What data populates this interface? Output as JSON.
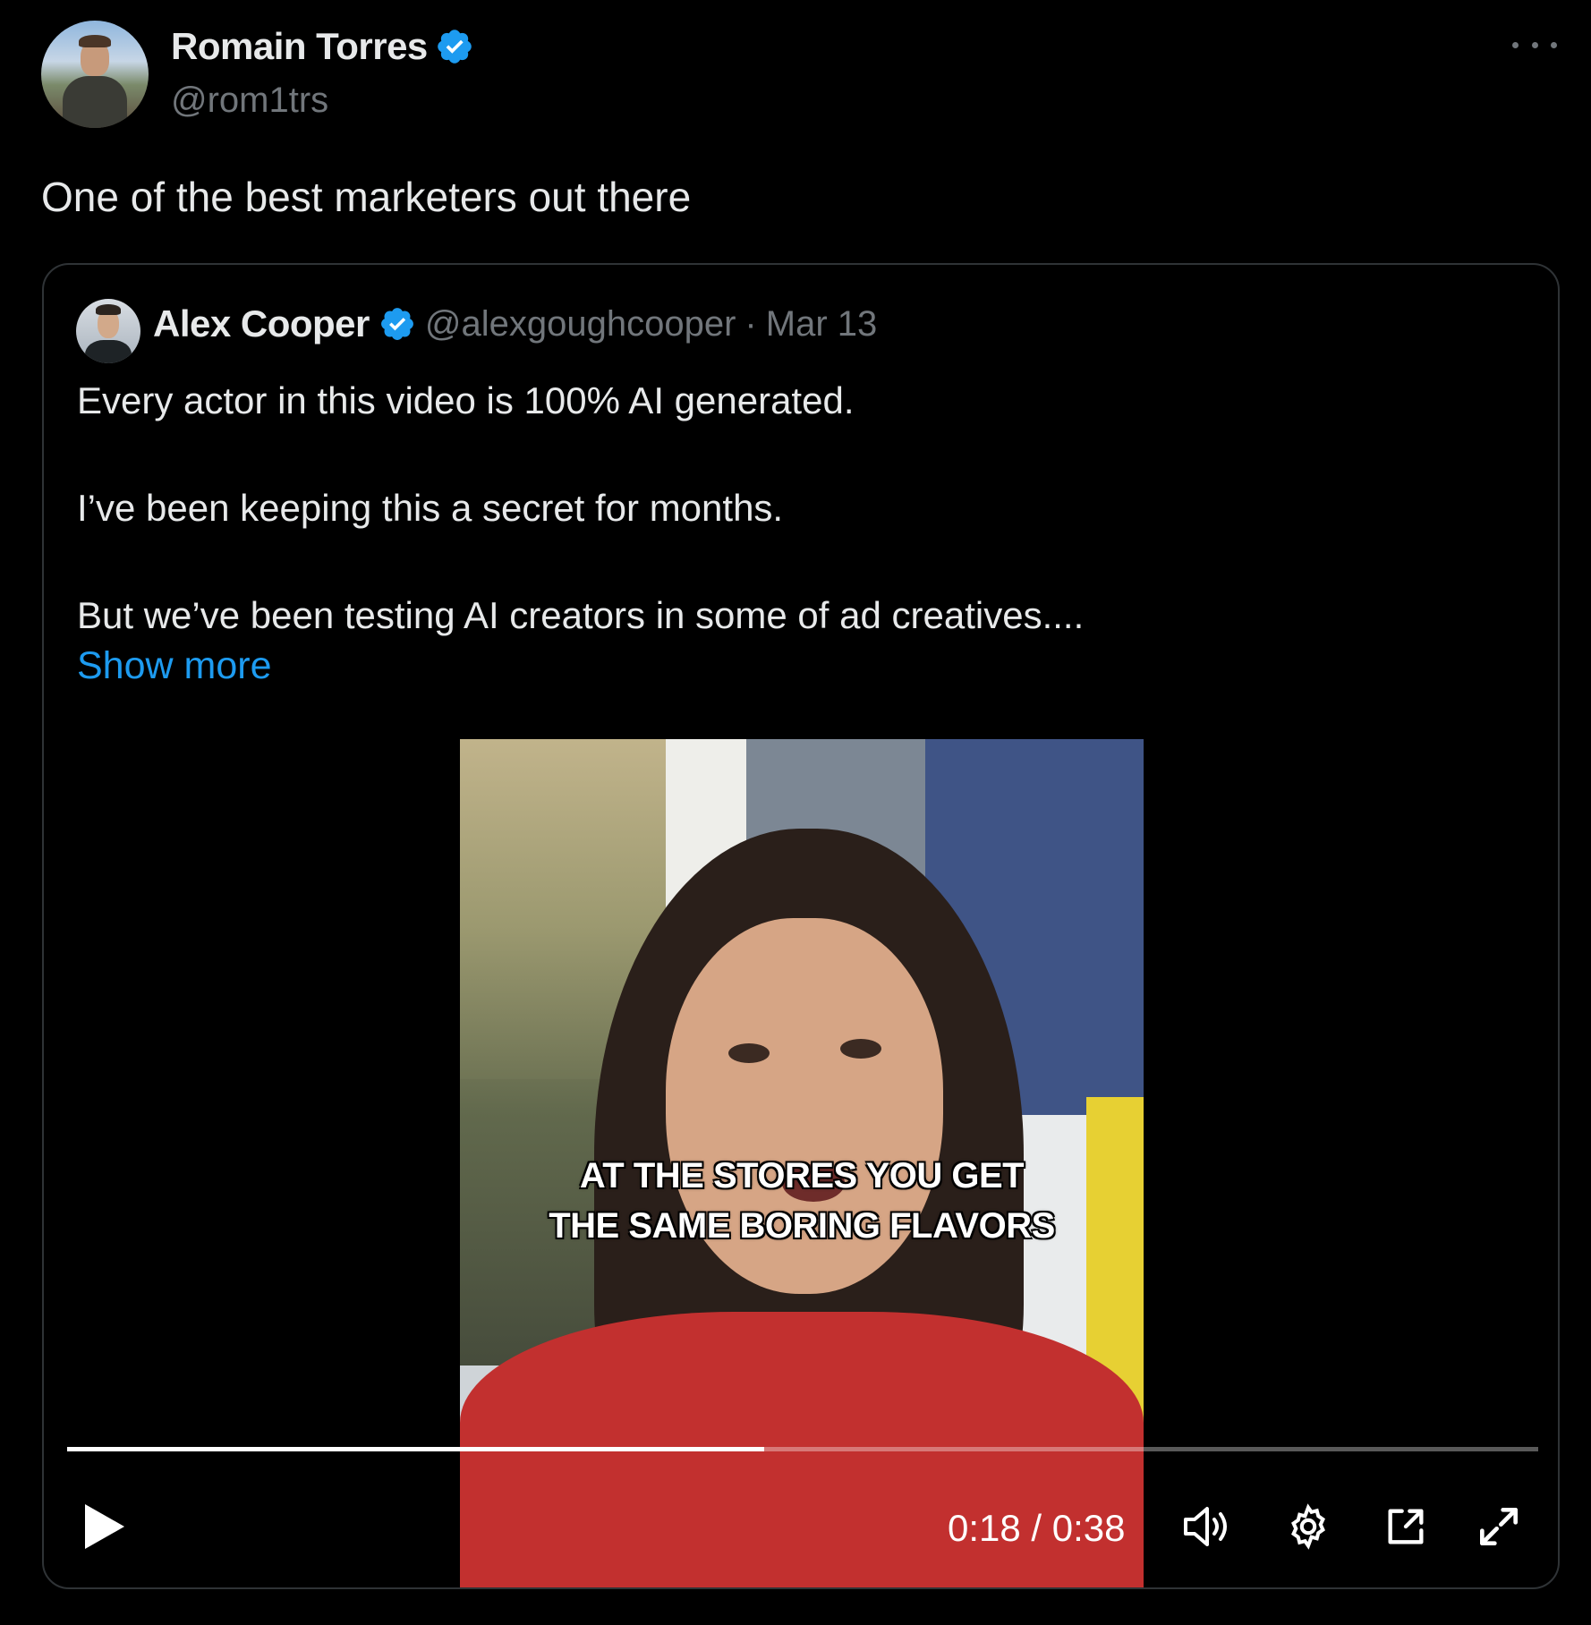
{
  "tweet": {
    "author": {
      "name": "Romain Torres",
      "handle": "@rom1trs"
    },
    "text": "One of the best marketers out there",
    "more_icon": "more-horizontal-icon",
    "verified_color": "#1d9bf0"
  },
  "quote": {
    "author": {
      "name": "Alex Cooper",
      "handle": "@alexgoughcooper",
      "separator": "·",
      "date": "Mar 13"
    },
    "lines": [
      "Every actor in this video is 100% AI generated.",
      "I’ve been keeping this a secret for months.",
      "But we’ve been testing AI creators in some of ad creatives...."
    ],
    "show_more": "Show more"
  },
  "video": {
    "caption_line1": "AT THE STORES YOU GET",
    "caption_line2": "THE SAME BORING FLAVORS",
    "time": "0:18 / 0:38",
    "progress_fraction": 0.4737,
    "controls": [
      "play-icon",
      "volume-icon",
      "settings-icon",
      "picture-in-picture-icon",
      "fullscreen-icon"
    ]
  },
  "colors": {
    "background": "#000000",
    "text": "#e7e9ea",
    "secondary": "#71767b",
    "accent": "#1d9bf0",
    "border": "#2f3336"
  }
}
